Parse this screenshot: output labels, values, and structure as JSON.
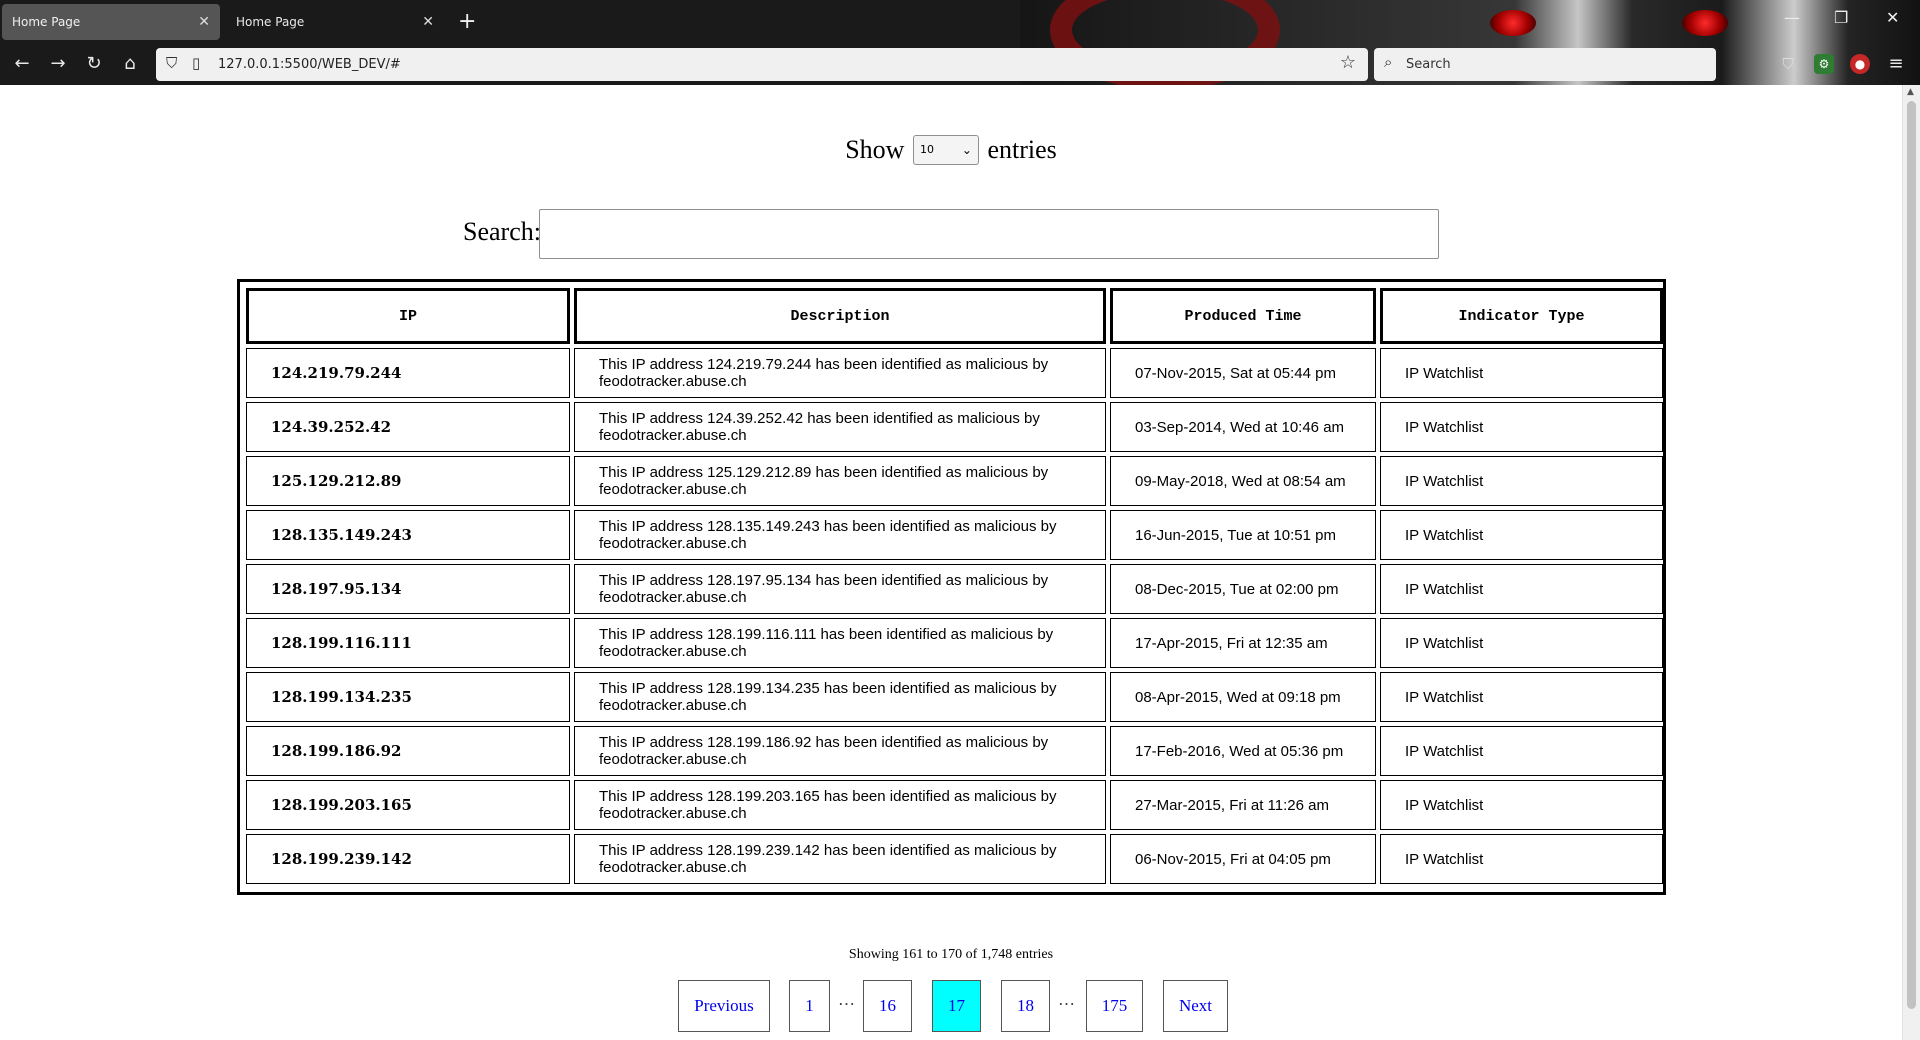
{
  "browser": {
    "tabs": [
      {
        "title": "Home Page",
        "active": true
      },
      {
        "title": "Home Page",
        "active": false
      }
    ],
    "url": "127.0.0.1:5500/WEB_DEV/#",
    "search_placeholder": "Search",
    "icons": {
      "back": "back-arrow-icon",
      "forward": "forward-arrow-icon",
      "reload": "reload-icon",
      "home": "home-icon",
      "bookmark": "star-icon",
      "pocket": "pocket-icon",
      "menu": "hamburger-menu-icon"
    }
  },
  "page": {
    "length": {
      "show_label": "Show",
      "selected": "10",
      "entries_label": "entries"
    },
    "search": {
      "label": "Search:",
      "value": ""
    },
    "table": {
      "headers": [
        "IP",
        "Description",
        "Produced Time",
        "Indicator Type"
      ],
      "rows": [
        {
          "ip": "124.219.79.244",
          "description": "This IP address 124.219.79.244 has been identified as malicious by feodotracker.abuse.ch",
          "time": "07-Nov-2015, Sat at 05:44 pm",
          "type": "IP Watchlist"
        },
        {
          "ip": "124.39.252.42",
          "description": "This IP address 124.39.252.42 has been identified as malicious by feodotracker.abuse.ch",
          "time": "03-Sep-2014, Wed at 10:46 am",
          "type": "IP Watchlist"
        },
        {
          "ip": "125.129.212.89",
          "description": "This IP address 125.129.212.89 has been identified as malicious by feodotracker.abuse.ch",
          "time": "09-May-2018, Wed at 08:54 am",
          "type": "IP Watchlist"
        },
        {
          "ip": "128.135.149.243",
          "description": "This IP address 128.135.149.243 has been identified as malicious by feodotracker.abuse.ch",
          "time": "16-Jun-2015, Tue at 10:51 pm",
          "type": "IP Watchlist"
        },
        {
          "ip": "128.197.95.134",
          "description": "This IP address 128.197.95.134 has been identified as malicious by feodotracker.abuse.ch",
          "time": "08-Dec-2015, Tue at 02:00 pm",
          "type": "IP Watchlist"
        },
        {
          "ip": "128.199.116.111",
          "description": "This IP address 128.199.116.111 has been identified as malicious by feodotracker.abuse.ch",
          "time": "17-Apr-2015, Fri at 12:35 am",
          "type": "IP Watchlist"
        },
        {
          "ip": "128.199.134.235",
          "description": "This IP address 128.199.134.235 has been identified as malicious by feodotracker.abuse.ch",
          "time": "08-Apr-2015, Wed at 09:18 pm",
          "type": "IP Watchlist"
        },
        {
          "ip": "128.199.186.92",
          "description": "This IP address 128.199.186.92 has been identified as malicious by feodotracker.abuse.ch",
          "time": "17-Feb-2016, Wed at 05:36 pm",
          "type": "IP Watchlist"
        },
        {
          "ip": "128.199.203.165",
          "description": "This IP address 128.199.203.165 has been identified as malicious by feodotracker.abuse.ch",
          "time": "27-Mar-2015, Fri at 11:26 am",
          "type": "IP Watchlist"
        },
        {
          "ip": "128.199.239.142",
          "description": "This IP address 128.199.239.142 has been identified as malicious by feodotracker.abuse.ch",
          "time": "06-Nov-2015, Fri at 04:05 pm",
          "type": "IP Watchlist"
        }
      ]
    },
    "info": "Showing 161 to 170 of 1,748 entries",
    "pagination": {
      "previous": "Previous",
      "pages": [
        "1",
        "16",
        "17",
        "18",
        "175"
      ],
      "ellipsis": "…",
      "current": "17",
      "next": "Next"
    }
  },
  "colors": {
    "current_page": "#00ffff",
    "link": "#0000ee"
  }
}
